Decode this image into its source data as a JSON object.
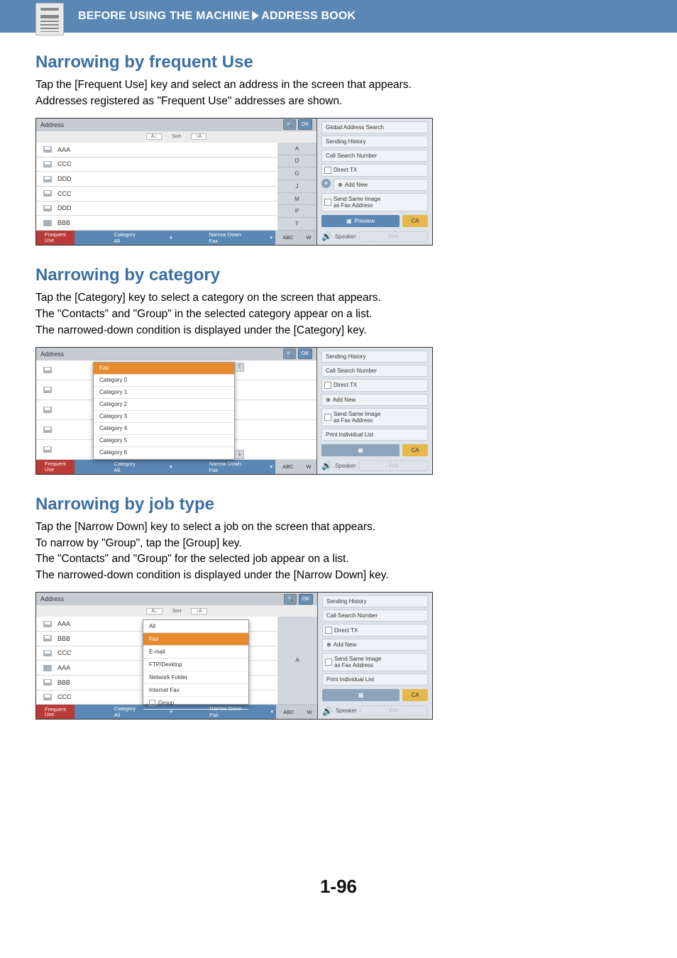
{
  "header": {
    "before": "BEFORE USING THE MACHINE",
    "arrow": "►",
    "section": "ADDRESS BOOK"
  },
  "s1": {
    "title": "Narrowing by frequent Use",
    "p1": "Tap the [Frequent Use] key and select an address in the screen that appears.",
    "p2": "Addresses registered as \"Frequent Use\" addresses are shown."
  },
  "s2": {
    "title": "Narrowing by category",
    "p1": "Tap the [Category] key to select a category on the screen that appears.",
    "p2": "The \"Contacts\" and \"Group\" in the selected category appear on a list.",
    "p3": "The narrowed-down condition is displayed under the [Category] key."
  },
  "s3": {
    "title": "Narrowing by job type",
    "p1": "Tap the [Narrow Down] key to select a job on the screen that appears.",
    "p2": "To narrow by \"Group\", tap the [Group] key.",
    "p3": "The \"Contacts\" and \"Group\" for the selected job appear on a list.",
    "p4": "The narrowed-down condition is displayed under the [Narrow Down] key."
  },
  "shot_common": {
    "address_label": "Address",
    "ok": "OK",
    "sort": "Sort",
    "freq_use": "Frequent\nUse",
    "category_all": "Category\nAll",
    "narrow_fax": "Narrow Down\nFax",
    "abc": "ABC",
    "w": "W",
    "speaker": "Speaker",
    "start": "Start"
  },
  "shot1": {
    "addresses": [
      "AAA",
      "CCC",
      "DDD",
      "CCC",
      "DDD",
      "BBB"
    ],
    "index": [
      "A",
      "D",
      "G",
      "J",
      "M",
      "P",
      "T"
    ],
    "right": {
      "items": [
        "Global Address Search",
        "Sending History",
        "Call Search Number",
        "Direct TX",
        "Add New",
        "Send Same Image\nas Fax Address"
      ],
      "preview": "Preview",
      "ca": "CA"
    }
  },
  "shot2": {
    "overlay": [
      "Fax",
      "Category 0",
      "Category 1",
      "Category 2",
      "Category 3",
      "Category 4",
      "Category 5",
      "Category 6"
    ],
    "right": {
      "items": [
        "Sending History",
        "Call Search Number",
        "Direct TX",
        "Add New",
        "Send Same Image\nas Fax Address",
        "Print Individual List"
      ],
      "ca": "CA"
    }
  },
  "shot3": {
    "addresses": [
      "AAA",
      "BBB",
      "CCC",
      "AAA",
      "BBB",
      "CCC"
    ],
    "overlay": [
      "All",
      "Fax",
      "E-mail",
      "FTP/Desktop",
      "Network Folder",
      "Internet Fax",
      "Group"
    ],
    "right": {
      "items": [
        "Sending History",
        "Call Search Number",
        "Direct TX",
        "Add New",
        "Send Same Image\nas Fax Address",
        "Print Individual List"
      ],
      "ca": "CA"
    }
  },
  "page_number": "1-96"
}
